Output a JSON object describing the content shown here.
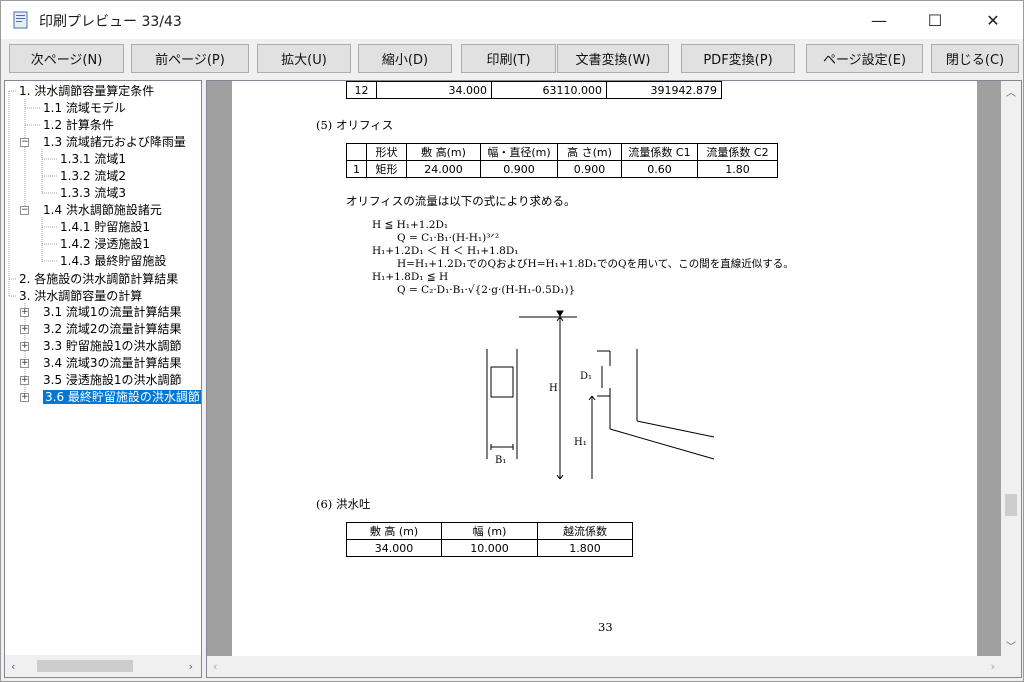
{
  "window": {
    "title": "印刷プレビュー 33/43"
  },
  "controls": {
    "minimize": "—",
    "maximize": "☐",
    "close": "✕"
  },
  "toolbar": {
    "buttons": [
      "次ページ(N)",
      "前ページ(P)",
      "拡大(U)",
      "縮小(D)",
      "印刷(T)",
      "文書変換(W)",
      "PDF変換(P)",
      "ページ設定(E)",
      "閉じる(C)"
    ]
  },
  "tree": {
    "items": [
      "1. 洪水調節容量算定条件",
      "1.1 流域モデル",
      "1.2 計算条件",
      "1.3 流域諸元および降雨量",
      "1.3.1 流域1",
      "1.3.2 流域2",
      "1.3.3 流域3",
      "1.4 洪水調節施設諸元",
      "1.4.1 貯留施設1",
      "1.4.2 浸透施設1",
      "1.4.3 最終貯留施設",
      "2. 各施設の洪水調節計算結果",
      "3. 洪水調節容量の計算",
      "3.1 流域1の流量計算結果",
      "3.2 流域2の流量計算結果",
      "3.3 貯留施設1の洪水調節",
      "3.4 流域3の流量計算結果",
      "3.5 浸透施設1の洪水調節",
      "3.6 最終貯留施設の洪水調節"
    ]
  },
  "doc": {
    "top_row": [
      "12",
      "34.000",
      "63110.000",
      "391942.879"
    ],
    "section5": "(5)  オリフィス",
    "orifice_headers": [
      "",
      "形状",
      "敷 高(m)",
      "幅・直径(m)",
      "高 さ(m)",
      "流量係数 C1",
      "流量係数 C2"
    ],
    "orifice_row": [
      "1",
      "矩形",
      "24.000",
      "0.900",
      "0.900",
      "0.60",
      "1.80"
    ],
    "orifice_note": "オリフィスの流量は以下の式により求める。",
    "formulas": [
      "H ≦ H₁+1.2D₁",
      "Q = C₁·B₁·(H-H₁)³ᐟ²",
      "H₁+1.2D₁ ＜ H ＜ H₁+1.8D₁",
      "H=H₁+1.2D₁でのQおよびH=H₁+1.8D₁でのQを用いて、この間を直線近似する。",
      "H₁+1.8D₁ ≦ H",
      "Q = C₂·D₁·B₁·√{2·g·(H-H₁-0.5D₁)}"
    ],
    "diagram_labels": {
      "H": "H",
      "H1": "H₁",
      "D1": "D₁",
      "B1": "B₁"
    },
    "section6": "(6)  洪水吐",
    "spillway_headers": [
      "敷 高 (m)",
      "幅 (m)",
      "越流係数"
    ],
    "spillway_row": [
      "34.000",
      "10.000",
      "1.800"
    ],
    "page_number": "33"
  }
}
